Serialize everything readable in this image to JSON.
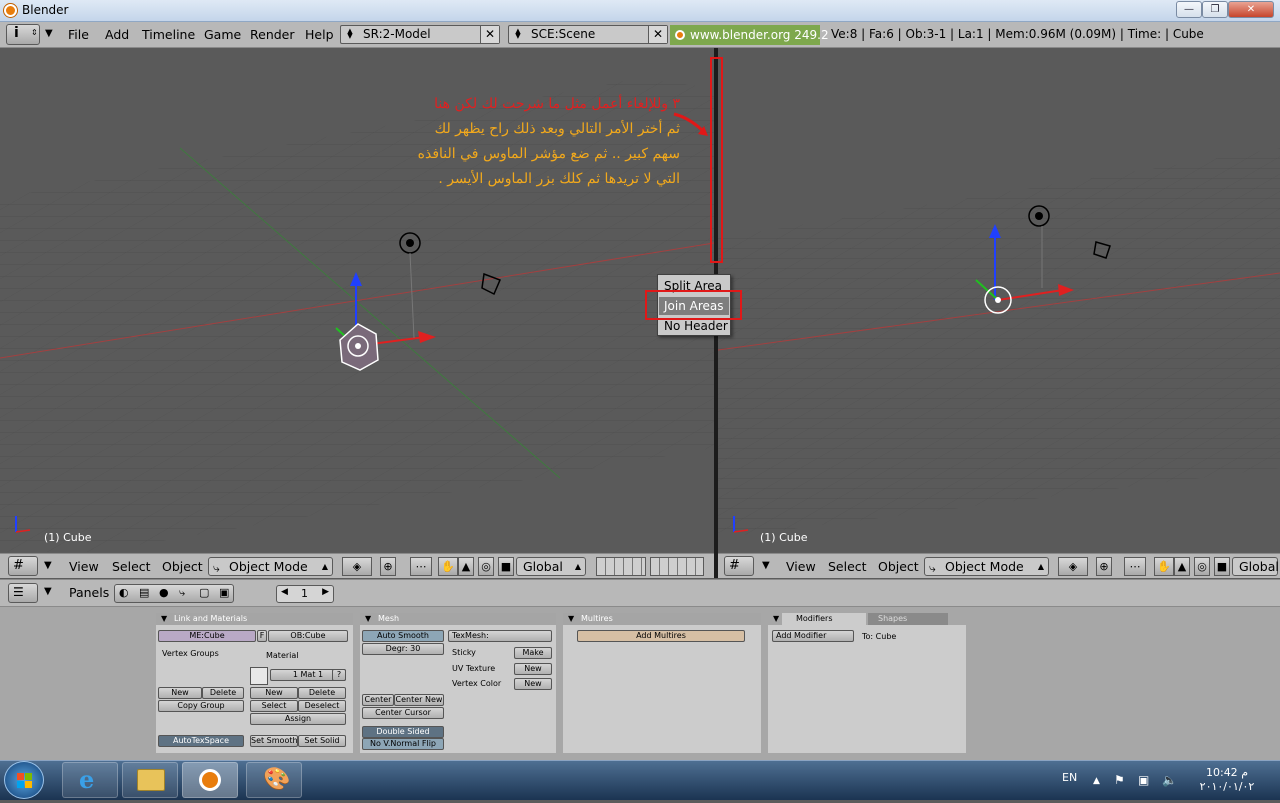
{
  "window": {
    "title": "Blender"
  },
  "menu": [
    "File",
    "Add",
    "Timeline",
    "Game",
    "Render",
    "Help"
  ],
  "screen_field": "SR:2-Model",
  "scene_field": "SCE:Scene",
  "url_badge": "www.blender.org 249.2",
  "stats": "Ve:8 | Fa:6 | Ob:3-1 | La:1  | Mem:0.96M (0.09M)  | Time: | Cube",
  "annotation": {
    "line1": "٣ وللإلغاء أعمل مثل ما شرحت لك لكن هنا",
    "line2": "ثم أختر الأمر التالي وبعد ذلك راح يظهر لك",
    "line3": "سهم كبير .. ثم ضع مؤشر الماوس في النافذه",
    "line4": "التي لا تريدها ثم كلك بزر الماوس الأيسر ."
  },
  "context_menu": {
    "items": [
      "Split Area",
      "Join Areas",
      "No Header"
    ]
  },
  "viewport_left": {
    "label": "(1) Cube"
  },
  "viewport_right": {
    "label": "(1) Cube"
  },
  "view_header": {
    "view": "View",
    "select": "Select",
    "object": "Object",
    "mode": "Object Mode",
    "orientation": "Global"
  },
  "buttons_header": {
    "panels": "Panels",
    "frame": "1"
  },
  "panels": {
    "link": {
      "title": "Link and Materials",
      "me": "ME:Cube",
      "f": "F",
      "ob": "OB:Cube",
      "vertex_groups": "Vertex Groups",
      "material": "Material",
      "mat_field": "1 Mat 1",
      "q": "?",
      "new": "New",
      "delete": "Delete",
      "copy_group": "Copy Group",
      "new2": "New",
      "delete2": "Delete",
      "select": "Select",
      "deselect": "Deselect",
      "assign": "Assign",
      "autotex": "AutoTexSpace",
      "set_smooth": "Set Smooth",
      "set_solid": "Set Solid"
    },
    "mesh": {
      "title": "Mesh",
      "auto_smooth": "Auto Smooth",
      "degr": "Degr: 30",
      "texmesh": "TexMesh:",
      "sticky": "Sticky",
      "make": "Make",
      "uv_texture": "UV Texture",
      "uv_new": "New",
      "vertex_color": "Vertex Color",
      "vc_new": "New",
      "center": "Center",
      "center_new": "Center New",
      "center_cursor": "Center Cursor",
      "double_sided": "Double Sided",
      "no_vnormal": "No V.Normal Flip"
    },
    "multires": {
      "title": "Multires",
      "add": "Add Multires"
    },
    "modifiers": {
      "tab1": "Modifiers",
      "tab2": "Shapes",
      "add": "Add Modifier",
      "to": "To: Cube"
    }
  },
  "taskbar": {
    "lang": "EN",
    "time": "10:42 م",
    "date": "٢٠١٠/٠١/٠٢"
  }
}
